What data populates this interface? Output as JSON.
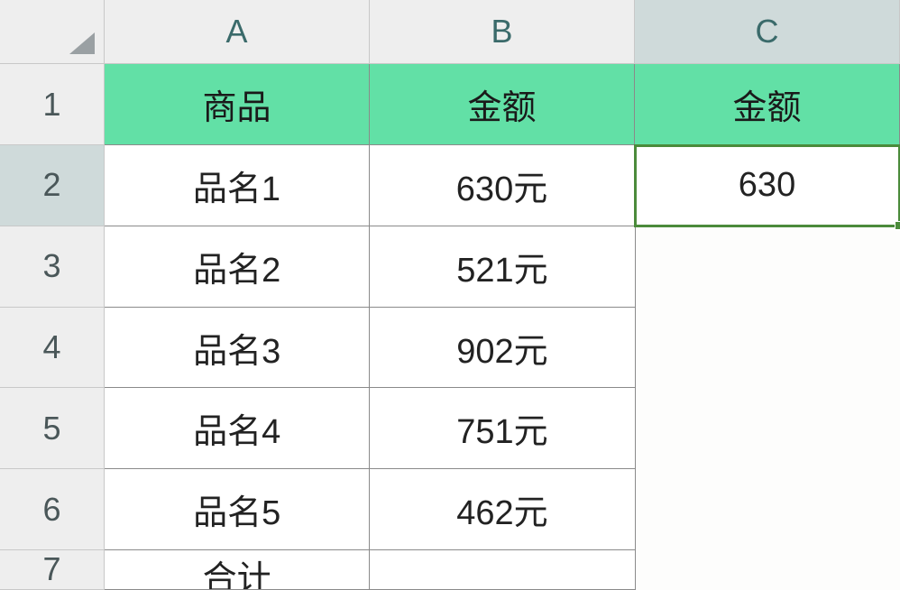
{
  "columns": [
    "A",
    "B",
    "C"
  ],
  "activeColumn": 2,
  "rows": [
    {
      "num": "1",
      "active": false,
      "cells": [
        {
          "v": "商品",
          "type": "header"
        },
        {
          "v": "金额",
          "type": "header"
        },
        {
          "v": "金额",
          "type": "header"
        }
      ]
    },
    {
      "num": "2",
      "active": true,
      "cells": [
        {
          "v": "品名1",
          "type": "data"
        },
        {
          "v": "630元",
          "type": "data"
        },
        {
          "v": "630",
          "type": "data",
          "selected": true
        }
      ]
    },
    {
      "num": "3",
      "active": false,
      "cells": [
        {
          "v": "品名2",
          "type": "data"
        },
        {
          "v": "521元",
          "type": "data"
        },
        {
          "v": "",
          "type": "empty"
        }
      ]
    },
    {
      "num": "4",
      "active": false,
      "cells": [
        {
          "v": "品名3",
          "type": "data"
        },
        {
          "v": "902元",
          "type": "data"
        },
        {
          "v": "",
          "type": "empty"
        }
      ]
    },
    {
      "num": "5",
      "active": false,
      "cells": [
        {
          "v": "品名4",
          "type": "data"
        },
        {
          "v": "751元",
          "type": "data"
        },
        {
          "v": "",
          "type": "empty"
        }
      ]
    },
    {
      "num": "6",
      "active": false,
      "cells": [
        {
          "v": "品名5",
          "type": "data"
        },
        {
          "v": "462元",
          "type": "data"
        },
        {
          "v": "",
          "type": "empty"
        }
      ]
    },
    {
      "num": "7",
      "active": false,
      "short": true,
      "cells": [
        {
          "v": "合计",
          "type": "data"
        },
        {
          "v": "",
          "type": "data"
        },
        {
          "v": "",
          "type": "empty"
        }
      ]
    }
  ]
}
